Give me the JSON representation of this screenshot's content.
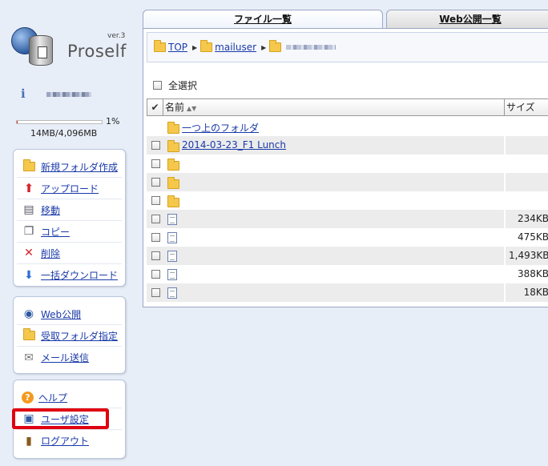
{
  "brand": {
    "name": "Proself",
    "version": "ver.3"
  },
  "user": {
    "info_icon": "info-icon",
    "usage_percent": 1,
    "usage_percent_label": "1%",
    "usage_text": "14MB/4,096MB"
  },
  "panels": {
    "file_ops": [
      {
        "label": "新規フォルダ作成",
        "icon": "new-folder-icon"
      },
      {
        "label": "アップロード",
        "icon": "upload-icon"
      },
      {
        "label": "移動",
        "icon": "move-icon"
      },
      {
        "label": "コピー",
        "icon": "copy-icon"
      },
      {
        "label": "削除",
        "icon": "delete-icon"
      },
      {
        "label": "一括ダウンロード",
        "icon": "bulk-download-icon"
      }
    ],
    "web_ops": [
      {
        "label": "Web公開",
        "icon": "globe-icon"
      },
      {
        "label": "受取フォルダ指定",
        "icon": "receive-folder-icon"
      },
      {
        "label": "メール送信",
        "icon": "mail-icon"
      }
    ],
    "account_ops": [
      {
        "label": "ヘルプ",
        "icon": "help-icon"
      },
      {
        "label": "ユーザ設定",
        "icon": "user-settings-icon"
      },
      {
        "label": "ログアウト",
        "icon": "logout-icon"
      }
    ]
  },
  "tabs": {
    "files": "ファイル一覧",
    "web": "Web公開一覧"
  },
  "breadcrumb": {
    "items": [
      "TOP",
      "mailuser"
    ]
  },
  "list": {
    "select_all": "全選択",
    "col_name": "名前",
    "col_size": "サイズ",
    "sort_glyph": "▲▼",
    "parent_folder": "一つ上のフォルダ",
    "rows": [
      {
        "type": "folder",
        "name": "2014-03-23_F1 Lunch",
        "size": ""
      },
      {
        "type": "folder",
        "name": "",
        "size": ""
      },
      {
        "type": "folder",
        "name": "",
        "size": ""
      },
      {
        "type": "folder",
        "name": "",
        "size": ""
      },
      {
        "type": "file",
        "name": "",
        "size": "234KB"
      },
      {
        "type": "file",
        "name": "",
        "size": "475KB"
      },
      {
        "type": "file",
        "name": "",
        "size": "1,493KB"
      },
      {
        "type": "file",
        "name": "",
        "size": "388KB"
      },
      {
        "type": "file",
        "name": "",
        "size": "18KB"
      }
    ]
  },
  "colors": {
    "highlight": "#e00010",
    "link": "#1a3aa8",
    "background": "#e8eef8"
  }
}
